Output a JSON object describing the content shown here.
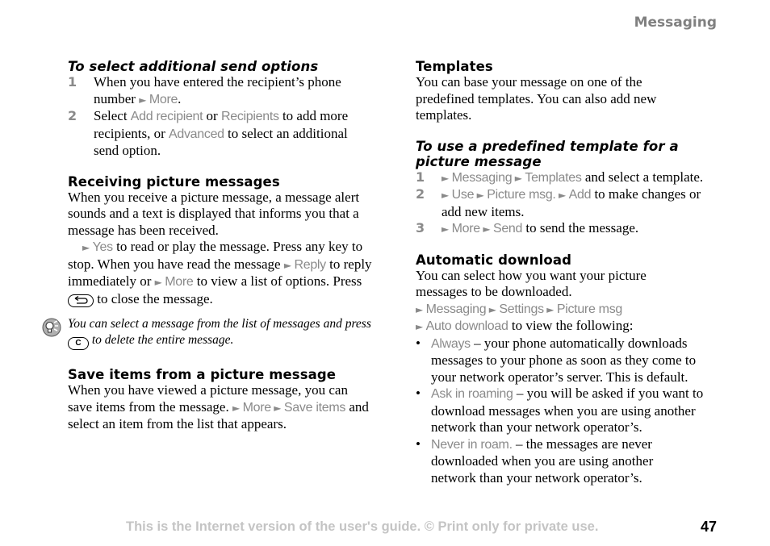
{
  "header": {
    "chapter": "Messaging"
  },
  "left": {
    "send_options": {
      "title": "To select additional send options",
      "steps": [
        {
          "num": "1",
          "pre": "When you have entered the recipient’s phone number ",
          "ui1": "More",
          "post": "."
        },
        {
          "num": "2",
          "pre": "Select ",
          "ui1": "Add recipient",
          "mid1": " or ",
          "ui2": "Recipients",
          "mid2": " to add more recipients, or ",
          "ui3": "Advanced",
          "post": " to select an additional send option."
        }
      ]
    },
    "receiving": {
      "title": "Receiving picture messages",
      "intro": "When you receive a picture message, a message alert sounds and a text is displayed that informs you that a message has been received.",
      "ui_yes": "Yes",
      "t1": " to read or play the message. Press any key to stop. When you have read the message ",
      "ui_reply": "Reply",
      "t2": " to reply immediately or ",
      "ui_more": "More",
      "t3": " to view a list of options. Press ",
      "key_back": "back-key",
      "t4": " to close the message."
    },
    "tip": {
      "icon": "lightbulb-tip-icon",
      "t1": "You can select a message from the list of messages and press ",
      "key_c": "C",
      "t2": " to delete the entire message."
    },
    "save_items": {
      "title": "Save items from a picture message",
      "t1": "When you have viewed a picture message, you can save items from the message. ",
      "ui_more": "More",
      "ui_save": "Save items",
      "t2": " and select an item from the list that appears."
    }
  },
  "right": {
    "templates": {
      "title": "Templates",
      "body": "You can base your message on one of the predefined templates. You can also add new templates."
    },
    "use_template": {
      "title": "To use a predefined template for a picture message",
      "steps": [
        {
          "num": "1",
          "ui": [
            "Messaging",
            "Templates"
          ],
          "post": " and select a template."
        },
        {
          "num": "2",
          "ui": [
            "Use",
            "Picture msg.",
            "Add"
          ],
          "post": " to make changes or add new items."
        },
        {
          "num": "3",
          "ui": [
            "More",
            "Send"
          ],
          "post": " to send the message."
        }
      ]
    },
    "auto_download": {
      "title": "Automatic download",
      "intro": "You can select how you want your picture messages to be downloaded.",
      "path1": [
        "Messaging",
        "Settings",
        "Picture msg"
      ],
      "path2": "Auto download",
      "path2_post": " to view the following:",
      "bullets": [
        {
          "ui": "Always",
          "text": " – your phone automatically downloads messages to your phone as soon as they come to your network operator’s server. This is default."
        },
        {
          "ui": "Ask in roaming",
          "text": " – you will be asked if you want to download messages when you are using another network than your network operator’s."
        },
        {
          "ui": "Never in roam.",
          "text": " – the messages are never downloaded when you are using another network than your network operator’s."
        }
      ]
    }
  },
  "footer": {
    "notice": "This is the Internet version of the user's guide. © Print only for private use.",
    "page_number": "47"
  },
  "glyphs": {
    "arrow": "►",
    "bullet": "•"
  }
}
